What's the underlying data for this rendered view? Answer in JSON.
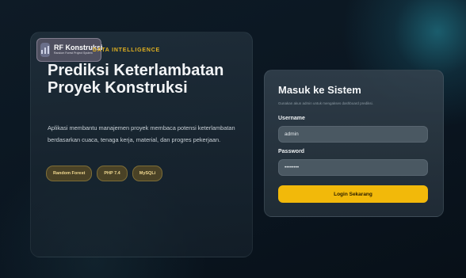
{
  "brand": {
    "name": "RF Konstruksi",
    "subtitle": "Random Forest Project System",
    "kicker": "DATA INTELLIGENCE"
  },
  "hero": {
    "title": "Prediksi Keterlambatan Proyek Konstruksi",
    "description": "Aplikasi membantu manajemen proyek membaca potensi keterlambatan berdasarkan cuaca, tenaga kerja, material, dan progres pekerjaan.",
    "tags": [
      "Random Forest",
      "PHP 7.4",
      "MySQLi"
    ]
  },
  "login": {
    "title": "Masuk ke Sistem",
    "subtitle": "Gunakan akun admin untuk mengakses dashboard prediksi.",
    "username_label": "Username",
    "username_value": "admin",
    "password_label": "Password",
    "password_value": "adminadm",
    "submit_label": "Login Sekarang"
  },
  "colors": {
    "accent": "#f2b90a",
    "background": "#0b1620",
    "tag_bg": "#4a4226"
  }
}
